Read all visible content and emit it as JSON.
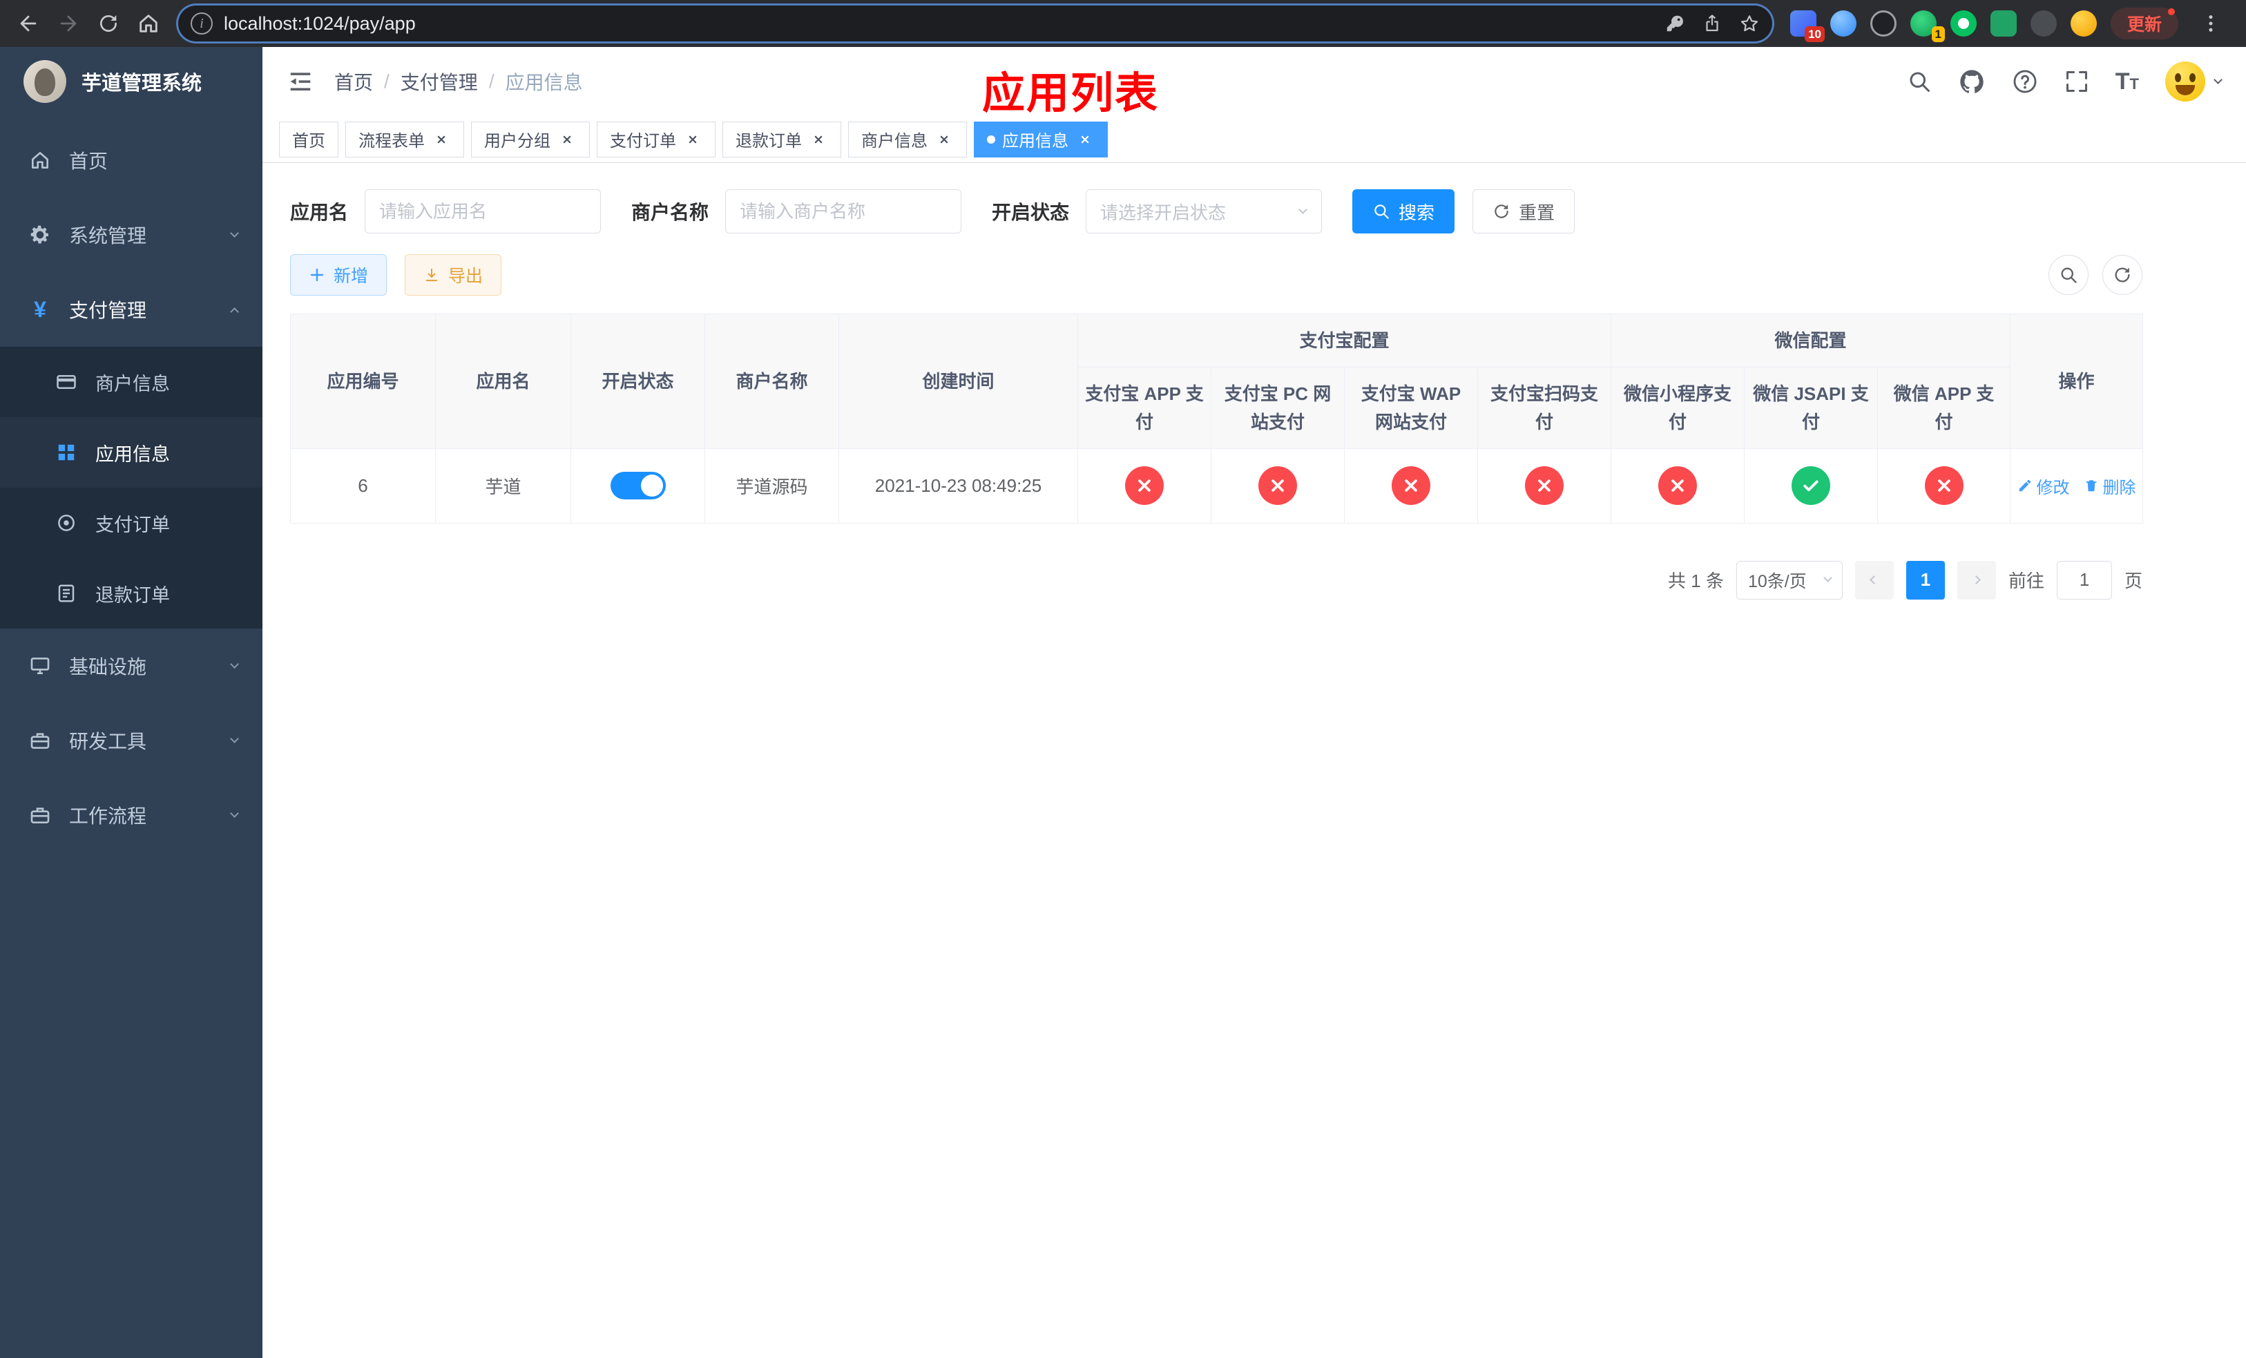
{
  "colors": {
    "sidebar_bg": "#304156",
    "submenu_bg": "#1f2d3d",
    "accent_blue": "#409eff",
    "button_blue": "#1890ff",
    "danger_red": "#fb4a4e",
    "success_green": "#1cc474",
    "overlay_title_red": "#fe0000",
    "export_yellow": "#e6a23c"
  },
  "icons": {
    "back": "left-arrow",
    "forward": "right-arrow",
    "reload": "circular-arrow",
    "home": "house",
    "site_info": "info-circle",
    "key": "password-key",
    "share": "box-with-up-arrow",
    "bookmark": "star-outline",
    "browser_menu": "vertical-dots",
    "sidebar_home": "house",
    "sidebar_system": "gear",
    "sidebar_payment": "yen-sign",
    "merchant": "credit-card",
    "app_info": "grid",
    "pay_order": "target-circle",
    "refund_order": "document",
    "infra": "monitor",
    "devtools": "briefcase",
    "workflow": "briefcase",
    "navbar_search": "magnifier",
    "navbar_github": "octocat",
    "navbar_help": "question-circle",
    "navbar_fullscreen": "expand-corners",
    "navbar_fontsize": "letter-T",
    "status_enabled": "check-in-circle",
    "status_disabled": "x-in-circle",
    "edit": "pencil",
    "delete": "trash"
  },
  "browser": {
    "url": "localhost:1024/pay/app",
    "update_button": "更新",
    "extension_badge_1": "10",
    "extension_badge_2": "1"
  },
  "sidebar": {
    "title": "芋道管理系统",
    "items": [
      {
        "label": "首页"
      },
      {
        "label": "系统管理"
      },
      {
        "label": "支付管理"
      },
      {
        "label": "基础设施"
      },
      {
        "label": "研发工具"
      },
      {
        "label": "工作流程"
      }
    ],
    "payment_submenu": [
      {
        "label": "商户信息"
      },
      {
        "label": "应用信息"
      },
      {
        "label": "支付订单"
      },
      {
        "label": "退款订单"
      }
    ]
  },
  "navbar": {
    "breadcrumb": [
      "首页",
      "支付管理",
      "应用信息"
    ],
    "overlay_title": "应用列表"
  },
  "tabs": [
    {
      "label": "首页"
    },
    {
      "label": "流程表单"
    },
    {
      "label": "用户分组"
    },
    {
      "label": "支付订单"
    },
    {
      "label": "退款订单"
    },
    {
      "label": "商户信息"
    },
    {
      "label": "应用信息"
    }
  ],
  "filters": {
    "app_name_label": "应用名",
    "app_name_placeholder": "请输入应用名",
    "merchant_label": "商户名称",
    "merchant_placeholder": "请输入商户名称",
    "status_label": "开启状态",
    "status_placeholder": "请选择开启状态",
    "search_button": "搜索",
    "reset_button": "重置"
  },
  "toolbar": {
    "add_button": "新增",
    "export_button": "导出"
  },
  "table": {
    "group_alipay": "支付宝配置",
    "group_wechat": "微信配置",
    "columns": [
      "应用编号",
      "应用名",
      "开启状态",
      "商户名称",
      "创建时间",
      "支付宝 APP 支付",
      "支付宝 PC 网站支付",
      "支付宝 WAP 网站支付",
      "支付宝扫码支付",
      "微信小程序支付",
      "微信 JSAPI 支付",
      "微信 APP 支付",
      "操作"
    ],
    "rows": [
      {
        "id": "6",
        "name": "芋道",
        "status_on": true,
        "merchant": "芋道源码",
        "created_at": "2021-10-23 08:49:25",
        "alipay_app": false,
        "alipay_pc": false,
        "alipay_wap": false,
        "alipay_qr": false,
        "wechat_mini": false,
        "wechat_jsapi": true,
        "wechat_app": false,
        "edit_label": "修改",
        "delete_label": "删除"
      }
    ]
  },
  "pagination": {
    "total_text": "共 1 条",
    "page_size_text": "10条/页",
    "active_page": "1",
    "goto_label": "前往",
    "goto_value": "1",
    "goto_suffix": "页"
  }
}
